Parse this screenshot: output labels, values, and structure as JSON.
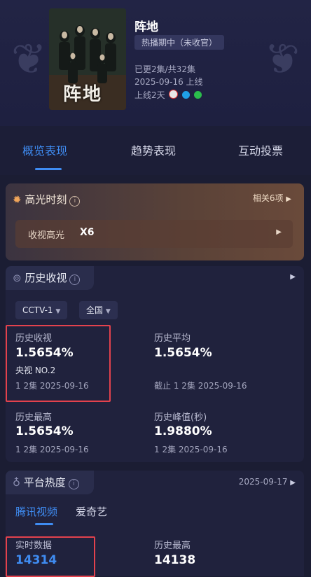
{
  "show": {
    "title": "阵地",
    "status": "热播期中（未收官）",
    "episodes": "已更2集/共32集",
    "premiere": "2025-09-16 上线",
    "days_online": "上线2天",
    "poster_title": "阵地"
  },
  "tabs": [
    "概览表现",
    "趋势表现",
    "互动投票"
  ],
  "highlight": {
    "heading": "高光时刻",
    "related": "相关6项",
    "item_label": "收视高光",
    "item_value": "X6"
  },
  "history": {
    "heading": "历史收视",
    "channel": "CCTV-1",
    "region": "全国",
    "stats": {
      "hist_rating_label": "历史收视",
      "hist_rating_value": "1.5654%",
      "hist_rating_rank": "央视 NO.2",
      "hist_rating_sub": "1 2集 2025-09-16",
      "hist_avg_label": "历史平均",
      "hist_avg_value": "1.5654%",
      "hist_avg_sub": "截止 1 2集 2025-09-16",
      "hist_max_label": "历史最高",
      "hist_max_value": "1.5654%",
      "hist_max_sub": "1 2集 2025-09-16",
      "hist_peak_label": "历史峰值(秒)",
      "hist_peak_value": "1.9880%",
      "hist_peak_sub": "1 2集 2025-09-16"
    }
  },
  "platform": {
    "heading": "平台热度",
    "date": "2025-09-17",
    "tabs": [
      "腾讯视频",
      "爱奇艺"
    ],
    "realtime_label": "实时数据",
    "realtime_value": "14314",
    "hist_max_label": "历史最高",
    "hist_max_value": "14138"
  },
  "colors": {
    "accent": "#3f8cf2",
    "highlight_box": "#e3424d"
  },
  "icons": [
    "laurel-left-icon",
    "laurel-right-icon",
    "flame-icon",
    "info-icon",
    "chevron-right-icon",
    "history-icon",
    "caret-down-icon",
    "heat-icon"
  ]
}
